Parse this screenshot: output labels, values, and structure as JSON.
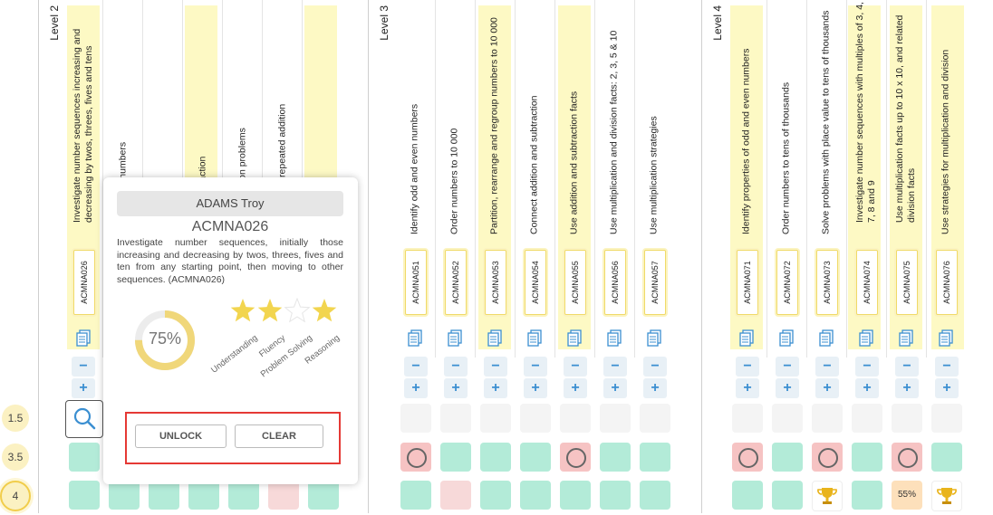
{
  "levels": [
    {
      "label": "Level 2"
    },
    {
      "label": "Level 3"
    },
    {
      "label": "Level 4"
    }
  ],
  "level2": {
    "descriptions": [
      "Investigate number sequences increasing and decreasing by twos, threes, fives and tens",
      "lel and order numbers",
      "ition numbers",
      "on and subtraction",
      "and subtraction problems",
      "ltiplication as repeated addition",
      "sion"
    ],
    "codes": [
      "ACMNA026"
    ]
  },
  "level3": {
    "descriptions": [
      "Identify odd and even numbers",
      "Order numbers to 10 000",
      "Partition, rearrange and regroup numbers to 10 000",
      "Connect addition and subtraction",
      "Use addition and subtraction facts",
      "Use multiplication and division facts: 2, 3, 5 & 10",
      "Use multiplication strategies"
    ],
    "codes": [
      "ACMNA051",
      "ACMNA052",
      "ACMNA053",
      "ACMNA054",
      "ACMNA055",
      "ACMNA056",
      "ACMNA057"
    ]
  },
  "level4": {
    "descriptions": [
      "Identify properties of odd and even numbers",
      "Order numbers to tens of thousands",
      "Solve problems with place value to tens of thousands",
      "Investigate number sequences with multiples of 3, 4, 6, 7, 8 and 9",
      "Use multiplication facts up to 10 x 10, and related division facts",
      "Use strategies for multiplication and division"
    ],
    "codes": [
      "ACMNA071",
      "ACMNA072",
      "ACMNA073",
      "ACMNA074",
      "ACMNA075",
      "ACMNA076"
    ]
  },
  "controls": {
    "minus": "−",
    "plus": "+"
  },
  "rows": [
    {
      "score": "1.5"
    },
    {
      "score": "3.5"
    },
    {
      "score": "4"
    }
  ],
  "percent_cell": "55%",
  "popup": {
    "student_name": "ADAMS Troy",
    "code": "ACMNA026",
    "description": "Investigate number sequences, initially those increasing and decreasing by twos, threes, fives and ten from any starting point, then moving to other sequences. (ACMNA026)",
    "progress_label": "75%",
    "progress_value": 0.75,
    "stars_filled": 3,
    "stars_total": 4,
    "star_labels": [
      "Understanding",
      "Fluency",
      "Problem Solving",
      "Reasoning"
    ],
    "unlock_label": "UNLOCK",
    "clear_label": "CLEAR"
  },
  "colors": {
    "highlight": "#fdf9c4",
    "mastered": "#b3ebd8",
    "not_mastered": "#f6c3c3",
    "star": "#f2d54f",
    "accent": "#3b8fd1",
    "frame": "#e53935"
  }
}
